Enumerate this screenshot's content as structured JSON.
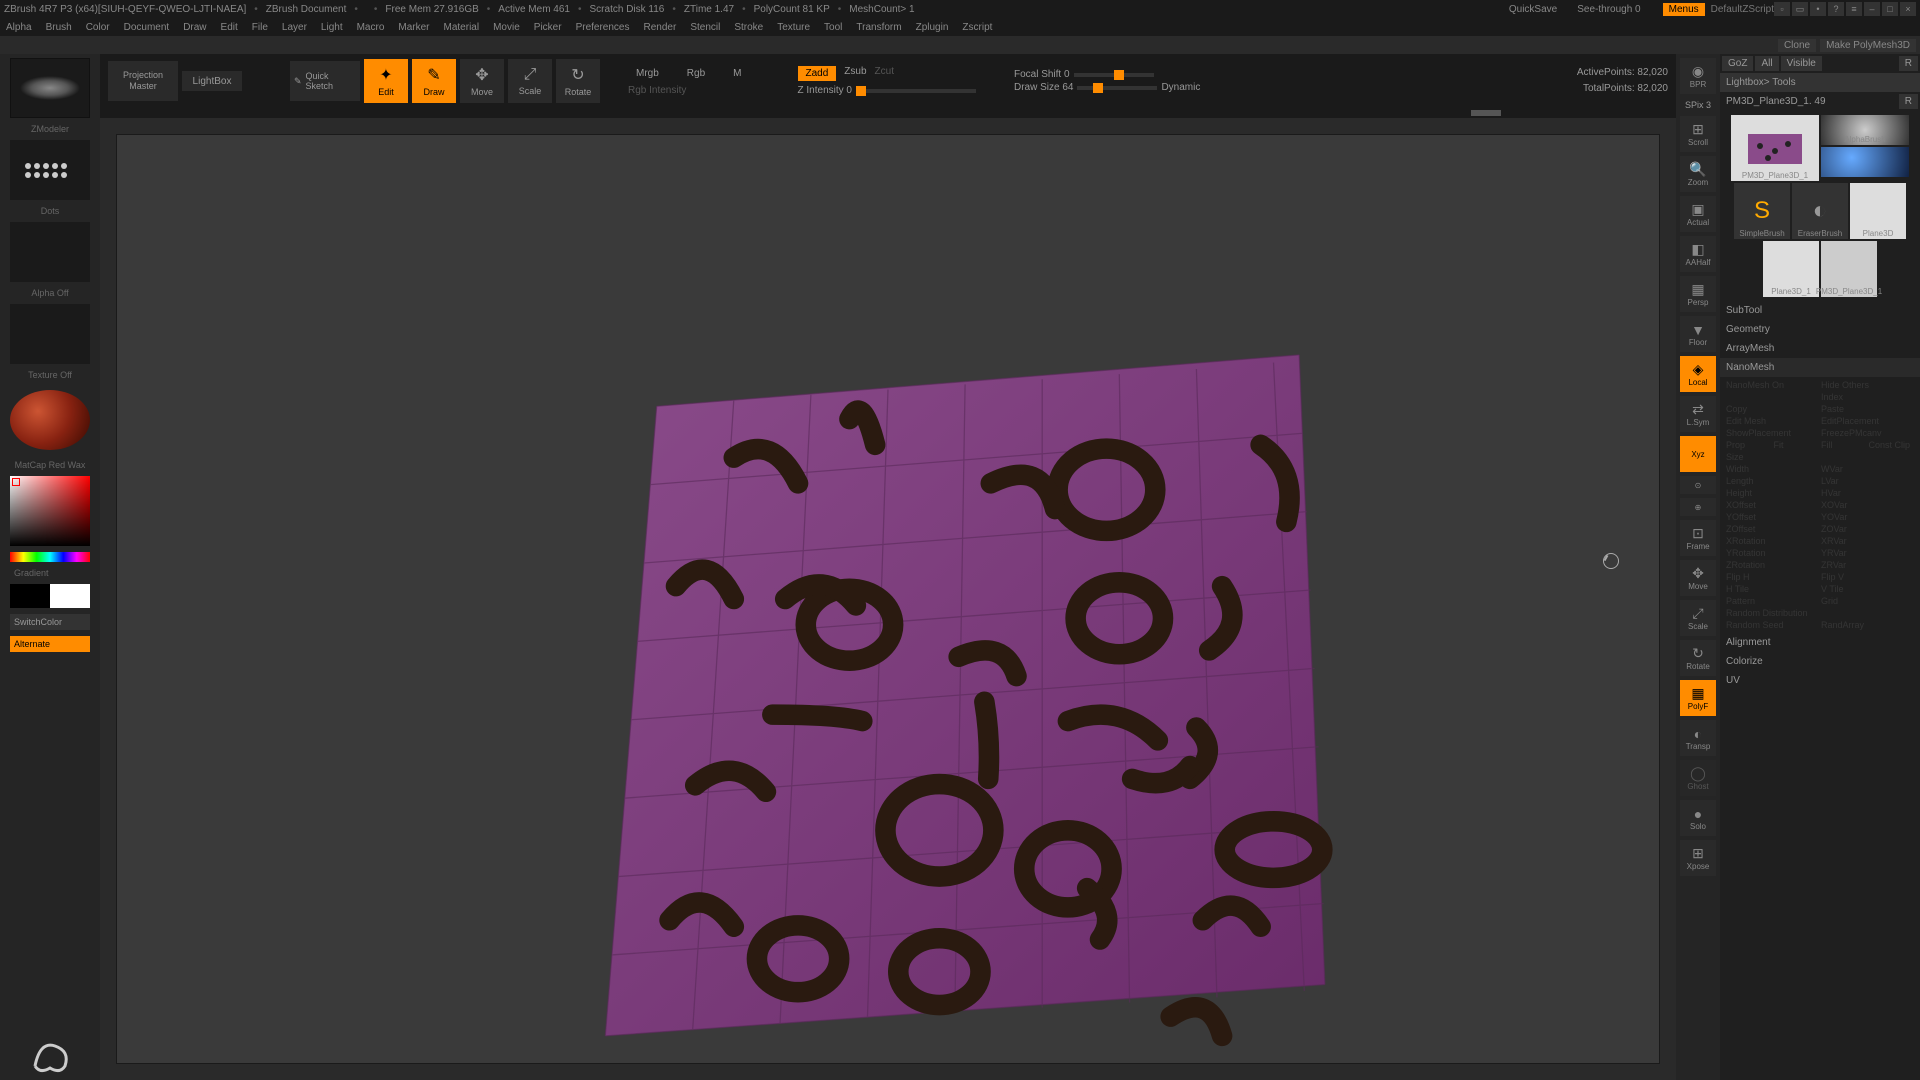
{
  "titlebar": {
    "app": "ZBrush 4R7 P3 (x64)[SIUH-QEYF-QWEO-LJTI-NAEA]",
    "doc": "ZBrush Document",
    "freemem": "Free Mem 27.916GB",
    "activemem": "Active Mem 461",
    "scratch": "Scratch Disk 116",
    "ztime": "ZTime 1.47",
    "polycount": "PolyCount 81 KP",
    "meshcount": "MeshCount> 1",
    "quicksave": "QuickSave",
    "seethrough": "See-through  0",
    "menus": "Menus",
    "script": "DefaultZScript"
  },
  "subbar": {
    "clone": "Clone",
    "makepolymesh": "Make PolyMesh3D"
  },
  "menu": [
    "Alpha",
    "Brush",
    "Color",
    "Document",
    "Draw",
    "Edit",
    "File",
    "Layer",
    "Light",
    "Macro",
    "Marker",
    "Material",
    "Movie",
    "Picker",
    "Preferences",
    "Render",
    "Stencil",
    "Stroke",
    "Texture",
    "Tool",
    "Transform",
    "Zplugin",
    "Zscript"
  ],
  "toolbar": {
    "projection": "Projection Master",
    "lightbox": "LightBox",
    "quicksketch": "Quick Sketch",
    "edit": "Edit",
    "draw": "Draw",
    "move": "Move",
    "scale": "Scale",
    "rotate": "Rotate",
    "mrgb": "Mrgb",
    "rgb": "Rgb",
    "m": "M",
    "rgbintensity": "Rgb Intensity",
    "zadd": "Zadd",
    "zsub": "Zsub",
    "zcut": "Zcut",
    "zintensity": "Z Intensity 0",
    "focalshift": "Focal Shift 0",
    "drawsize": "Draw Size 64",
    "dynamic": "Dynamic",
    "activepoints": "ActivePoints: 82,020",
    "totalpoints": "TotalPoints: 82,020"
  },
  "left": {
    "zmodeler": "ZModeler",
    "dots": "Dots",
    "alpha_off": "Alpha Off",
    "texture_off": "Texture Off",
    "matcap": "MatCap Red Wax",
    "gradient": "Gradient",
    "switchcolor": "SwitchColor",
    "alternate": "Alternate"
  },
  "righttools": {
    "bpr": "BPR",
    "spix": "SPix 3",
    "scroll": "Scroll",
    "zoom": "Zoom",
    "actual": "Actual",
    "aahalf": "AAHalf",
    "persp": "Persp",
    "floor": "Floor",
    "local": "Local",
    "lsym": "L.Sym",
    "xyz": "Xyz",
    "frame": "Frame",
    "move": "Move",
    "scale": "Scale",
    "rotate": "Rotate",
    "polyf": "PolyF",
    "transp": "Transp",
    "ghost": "Ghost",
    "solo": "Solo",
    "xpose": "Xpose"
  },
  "rightpanel": {
    "goz": "GoZ",
    "all": "All",
    "visible": "Visible",
    "r": "R",
    "lightbox_tools": "Lightbox> Tools",
    "toolname": "PM3D_Plane3D_1. 49",
    "tools": [
      {
        "name": "PM3D_Plane3D_1"
      },
      {
        "name": "AlphaBrush"
      },
      {
        "name": "SimpleBrush"
      },
      {
        "name": "EraserBrush"
      },
      {
        "name": "Plane3D"
      },
      {
        "name": "Plane3D_1"
      },
      {
        "name": "PM3D_Plane3D_1"
      }
    ],
    "sections": {
      "subtool": "SubTool",
      "geometry": "Geometry",
      "arraymesh": "ArrayMesh",
      "nanomesh": "NanoMesh",
      "alignment": "Alignment",
      "colorize": "Colorize",
      "uv": "UV"
    },
    "nano": {
      "nanomesh_on": "NanoMesh On",
      "hide_others": "Hide Others",
      "index": "Index",
      "copy": "Copy",
      "paste": "Paste",
      "editmesh": "Edit Mesh",
      "editplacement": "EditPlacement",
      "showplacement": "ShowPlacement",
      "freezepmcanv": "FreezePMcanv",
      "prop": "Prop",
      "fit": "Fit",
      "fill": "Fill",
      "constclip": "Const Clip",
      "size": "Size",
      "width": "Width",
      "wvar": "WVar",
      "length": "Length",
      "lvar": "LVar",
      "height": "Height",
      "hvar": "HVar",
      "xoffset": "XOffset",
      "xovar": "XOVar",
      "yoffset": "YOffset",
      "yovar": "YOVar",
      "zoffset": "ZOffset",
      "zovar": "ZOVar",
      "xrotation": "XRotation",
      "xrvar": "XRVar",
      "yrotation": "YRotation",
      "yrvar": "YRVar",
      "zrotation": "ZRotation",
      "zrvar": "ZRVar",
      "fliph": "Flip H",
      "flipv": "Flip V",
      "htile": "H Tile",
      "vtile": "V Tile",
      "pattern": "Pattern",
      "grid": "Grid",
      "randomdist": "Random Distribution",
      "randomseed": "Random Seed",
      "randarray": "RandArray"
    }
  }
}
